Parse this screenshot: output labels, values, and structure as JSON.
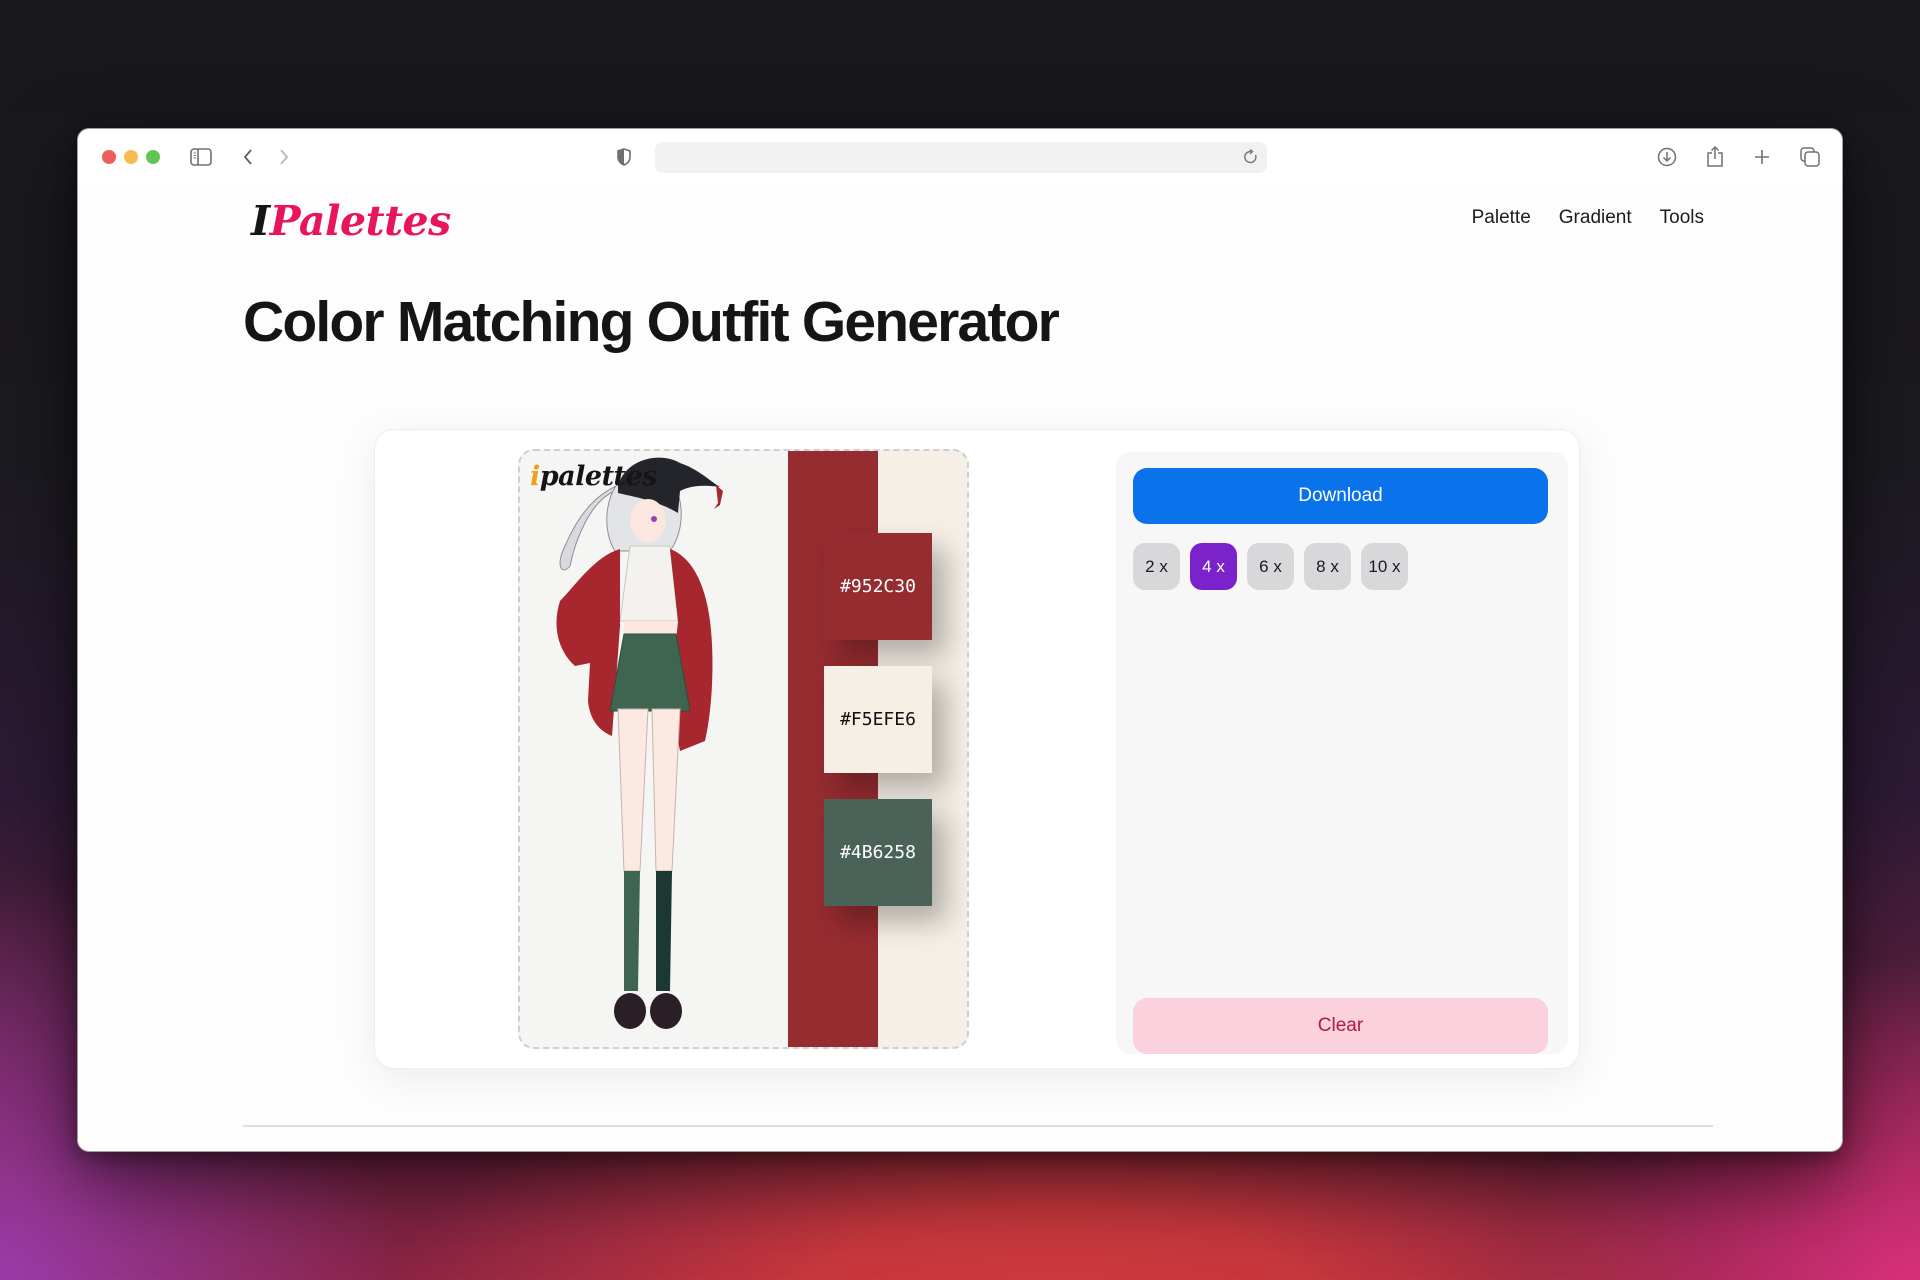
{
  "browser": {
    "address": "",
    "icons": {
      "sidebar": "sidebar-icon",
      "back": "chevron-left-icon",
      "forward": "chevron-right-icon",
      "privacy": "shield-icon",
      "reload": "reload-icon",
      "downloads": "download-circle-icon",
      "share": "share-icon",
      "new_tab": "plus-icon",
      "tabs": "tabs-overview-icon"
    }
  },
  "header": {
    "logo_prefix": "I",
    "logo_main": "Palettes",
    "nav": [
      {
        "label": "Palette"
      },
      {
        "label": "Gradient"
      },
      {
        "label": "Tools"
      }
    ]
  },
  "page": {
    "title": "Color Matching Outfit Generator"
  },
  "preview": {
    "watermark_dot": "i",
    "watermark_text": "palettes",
    "illustration": "anime girl outfit: red jacket, white cropped sweater, green pleated skirt, black beanie",
    "stripe_colors": [
      "#952C30",
      "#F5EFE6"
    ],
    "swatches": [
      {
        "hex": "#952C30",
        "text_color": "#ffffff"
      },
      {
        "hex": "#F5EFE6",
        "text_color": "#111111"
      },
      {
        "hex": "#4B6258",
        "text_color": "#ffffff"
      }
    ]
  },
  "controls": {
    "download_label": "Download",
    "scales": [
      {
        "label": "2 x",
        "selected": false
      },
      {
        "label": "4 x",
        "selected": true
      },
      {
        "label": "6 x",
        "selected": false
      },
      {
        "label": "8 x",
        "selected": false
      },
      {
        "label": "10 x",
        "selected": false
      }
    ],
    "clear_label": "Clear"
  },
  "colors": {
    "brand_pink": "#E8145C",
    "download_blue": "#0A72EA",
    "scale_selected": "#7B22CC",
    "clear_bg": "#FAD1DD",
    "clear_text": "#B0184A"
  }
}
